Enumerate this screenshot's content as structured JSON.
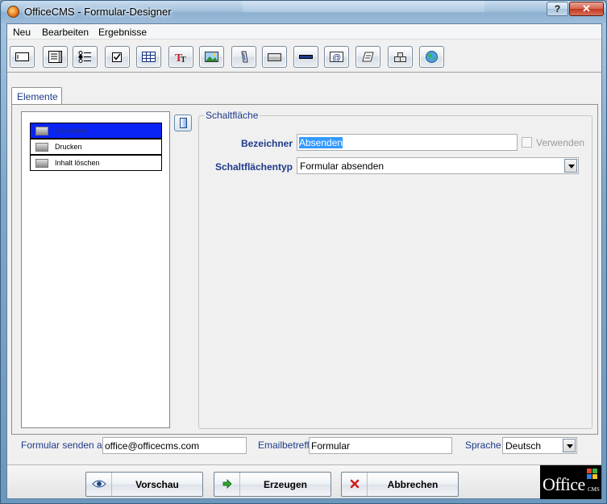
{
  "window": {
    "title": "OfficeCMS - Formular-Designer",
    "help_label": "?",
    "close_label": "✕"
  },
  "menu": {
    "items": [
      {
        "label": "Neu"
      },
      {
        "label": "Bearbeiten"
      },
      {
        "label": "Ergebnisse"
      }
    ]
  },
  "toolbar": {
    "buttons": [
      {
        "icon": "textfield-icon"
      },
      {
        "icon": "textarea-icon"
      },
      {
        "icon": "radio-list-icon"
      },
      {
        "icon": "checkbox-icon"
      },
      {
        "icon": "table-icon"
      },
      {
        "icon": "text-format-icon"
      },
      {
        "icon": "image-icon"
      },
      {
        "icon": "attachment-icon"
      },
      {
        "icon": "button-icon"
      },
      {
        "icon": "separator-icon"
      },
      {
        "icon": "email-icon"
      },
      {
        "icon": "label-icon"
      },
      {
        "icon": "hidden-field-icon"
      },
      {
        "icon": "web-icon"
      }
    ]
  },
  "tabs": [
    {
      "label": "Elemente"
    }
  ],
  "elements_list": {
    "items": [
      {
        "label": "Absenden",
        "selected": true
      },
      {
        "label": "Drucken",
        "selected": false
      },
      {
        "label": "Inhalt löschen",
        "selected": false
      }
    ]
  },
  "properties": {
    "group_title": "Schaltfläche",
    "bezeichner_label": "Bezeichner",
    "bezeichner_value": "Absenden",
    "verwenden_label": "Verwenden",
    "verwenden_checked": false,
    "typ_label": "Schaltflächentyp",
    "typ_value": "Formular absenden"
  },
  "footer_fields": {
    "send_to_label": "Formular senden an",
    "send_to_value": "office@officecms.com",
    "subject_label": "Emailbetreff",
    "subject_value": "Formular",
    "language_label": "Sprache",
    "language_value": "Deutsch"
  },
  "actions": {
    "preview_label": "Vorschau",
    "generate_label": "Erzeugen",
    "cancel_label": "Abbrechen"
  },
  "logo": {
    "text": "Office",
    "subtext": "CMS"
  },
  "colors": {
    "accent_label": "#1e3a8a",
    "selection": "#0a24f5",
    "text_selection": "#3399ff"
  }
}
